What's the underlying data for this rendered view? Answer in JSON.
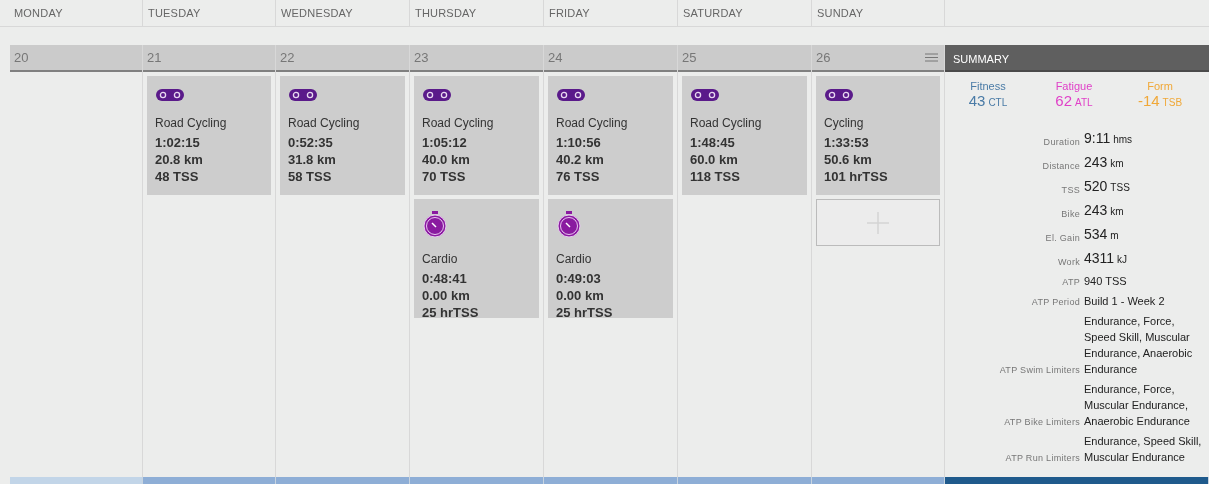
{
  "days": [
    {
      "name": "MONDAY",
      "date": "20",
      "menu": false,
      "add": false
    },
    {
      "name": "TUESDAY",
      "date": "21",
      "menu": false,
      "add": false,
      "workouts": [
        {
          "kind": "bike",
          "title": "Road Cycling",
          "duration": "1:02:15",
          "distance": "20.8",
          "distance_unit": "km",
          "load": "48",
          "load_unit": "TSS"
        }
      ]
    },
    {
      "name": "WEDNESDAY",
      "date": "22",
      "menu": false,
      "add": false,
      "workouts": [
        {
          "kind": "bike",
          "title": "Road Cycling",
          "duration": "0:52:35",
          "distance": "31.8",
          "distance_unit": "km",
          "load": "58",
          "load_unit": "TSS"
        }
      ]
    },
    {
      "name": "THURSDAY",
      "date": "23",
      "menu": false,
      "add": false,
      "workouts": [
        {
          "kind": "bike",
          "title": "Road Cycling",
          "duration": "1:05:12",
          "distance": "40.0",
          "distance_unit": "km",
          "load": "70",
          "load_unit": "TSS"
        },
        {
          "kind": "cardio",
          "title": "Cardio",
          "duration": "0:48:41",
          "distance": "0.00",
          "distance_unit": "km",
          "load": "25",
          "load_unit": "hrTSS"
        }
      ]
    },
    {
      "name": "FRIDAY",
      "date": "24",
      "menu": false,
      "add": false,
      "workouts": [
        {
          "kind": "bike",
          "title": "Road Cycling",
          "duration": "1:10:56",
          "distance": "40.2",
          "distance_unit": "km",
          "load": "76",
          "load_unit": "TSS"
        },
        {
          "kind": "cardio",
          "title": "Cardio",
          "duration": "0:49:03",
          "distance": "0.00",
          "distance_unit": "km",
          "load": "25",
          "load_unit": "hrTSS"
        }
      ]
    },
    {
      "name": "SATURDAY",
      "date": "25",
      "menu": false,
      "add": false,
      "workouts": [
        {
          "kind": "bike",
          "title": "Road Cycling",
          "duration": "1:48:45",
          "distance": "60.0",
          "distance_unit": "km",
          "load": "118",
          "load_unit": "TSS"
        }
      ]
    },
    {
      "name": "SUNDAY",
      "date": "26",
      "menu": true,
      "add": true,
      "workouts": [
        {
          "kind": "bike",
          "title": "Cycling",
          "duration": "1:33:53",
          "distance": "50.6",
          "distance_unit": "km",
          "load": "101",
          "load_unit": "hrTSS"
        }
      ]
    }
  ],
  "summary": {
    "title": "SUMMARY",
    "metrics": [
      {
        "label": "Fitness",
        "value": "43",
        "unit": "CTL",
        "color": "#4a7ba6"
      },
      {
        "label": "Fatigue",
        "value": "62",
        "unit": "ATL",
        "color": "#e040c8"
      },
      {
        "label": "Form",
        "value": "-14",
        "unit": "TSB",
        "color": "#f0a838"
      }
    ],
    "rows": [
      {
        "kind": "big",
        "label": "Duration",
        "value": "9:11",
        "unit": "hms"
      },
      {
        "kind": "big",
        "label": "Distance",
        "value": "243",
        "unit": "km"
      },
      {
        "kind": "big",
        "label": "TSS",
        "value": "520",
        "unit": "TSS"
      },
      {
        "kind": "big",
        "label": "Bike",
        "value": "243",
        "unit": "km"
      },
      {
        "kind": "big",
        "label": "El. Gain",
        "value": "534",
        "unit": "m"
      },
      {
        "kind": "big",
        "label": "Work",
        "value": "4311",
        "unit": "kJ"
      },
      {
        "kind": "text",
        "label": "ATP",
        "value": "940 TSS"
      },
      {
        "kind": "text",
        "label": "ATP Period",
        "value": "Build 1 - Week 2"
      },
      {
        "kind": "text",
        "label": "ATP Swim Limiters",
        "value": "Endurance, Force, Speed Skill, Muscular Endurance, Anaerobic Endurance"
      },
      {
        "kind": "text",
        "label": "ATP Bike Limiters",
        "value": "Endurance, Force, Muscular Endurance, Anaerobic Endurance"
      },
      {
        "kind": "text",
        "label": "ATP Run Limiters",
        "value": "Endurance, Speed Skill, Muscular Endurance"
      }
    ]
  }
}
